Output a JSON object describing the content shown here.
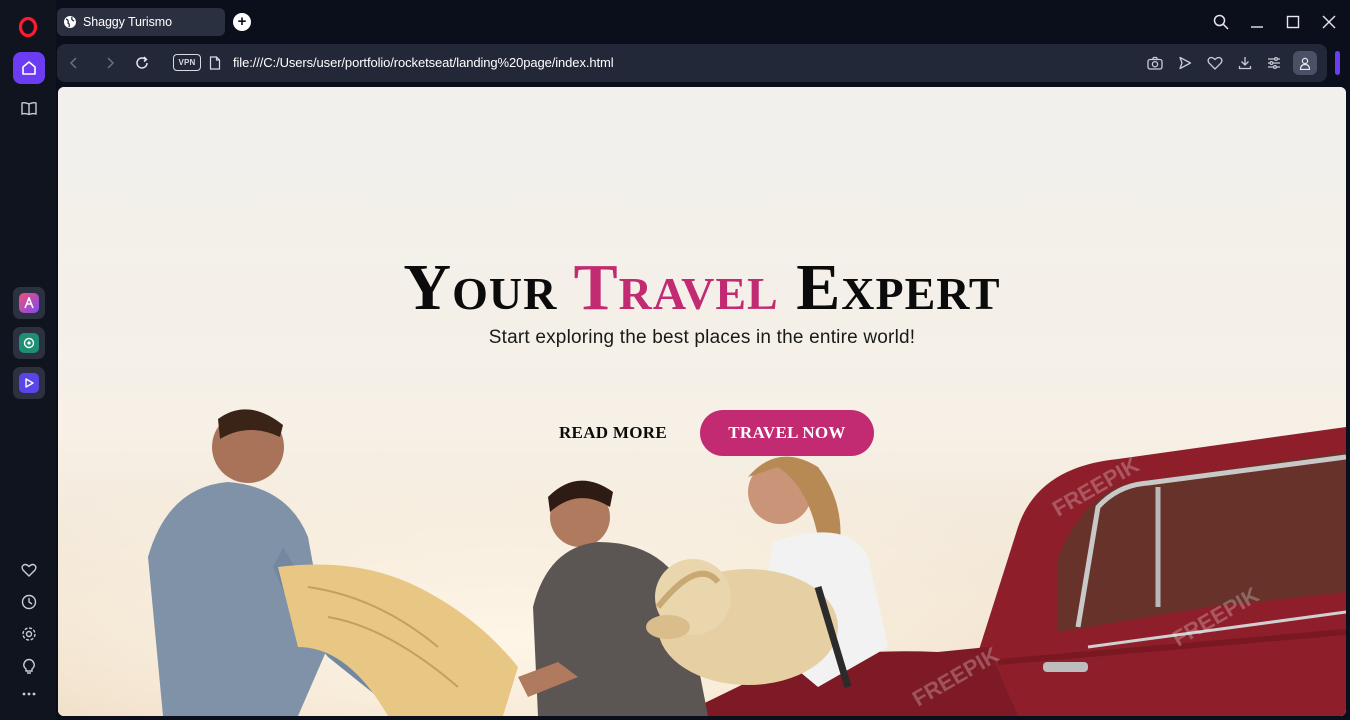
{
  "browser": {
    "tab": {
      "title": "Shaggy Turismo",
      "icon": "globe-icon"
    },
    "new_tab_label": "+",
    "address": {
      "vpn_label": "VPN",
      "url": "file:///C:/Users/user/portfolio/rocketseat/landing%20page/index.html"
    },
    "accent_color": "#6b3cf2"
  },
  "sidebar": {
    "items": [
      "home-icon",
      "reader-icon",
      "aria-icon",
      "chatgpt-icon",
      "player-icon",
      "heart-icon",
      "history-icon",
      "settings-icon",
      "bulb-icon",
      "more-icon"
    ]
  },
  "page": {
    "title_part1": "Your",
    "title_accent": "Travel",
    "title_part2": "Expert",
    "subtitle": "Start exploring the best places in the entire world!",
    "read_more": "READ MORE",
    "travel_now": "TRAVEL NOW",
    "brand_color": "#c22a72",
    "image": "Friends with map, dog and red vintage car at sunset"
  }
}
